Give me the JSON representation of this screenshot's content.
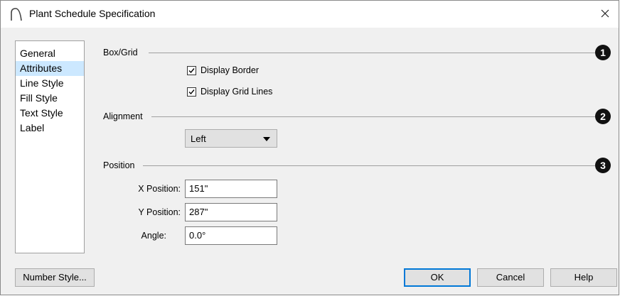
{
  "window": {
    "title": "Plant Schedule Specification",
    "close_glyph": "×",
    "icon": "arch-icon"
  },
  "sidebar": {
    "items": [
      {
        "label": "General",
        "active": false
      },
      {
        "label": "Attributes",
        "active": true
      },
      {
        "label": "Line Style",
        "active": false
      },
      {
        "label": "Fill Style",
        "active": false
      },
      {
        "label": "Text Style",
        "active": false
      },
      {
        "label": "Label",
        "active": false
      }
    ]
  },
  "box_grid": {
    "title": "Box/Grid",
    "badge": "1",
    "display_border": {
      "label": "Display Border",
      "checked": true
    },
    "display_grid_lines": {
      "label": "Display Grid Lines",
      "checked": true
    }
  },
  "alignment": {
    "title": "Alignment",
    "badge": "2",
    "selected": "Left"
  },
  "position": {
    "title": "Position",
    "badge": "3",
    "x_label": "X Position:",
    "x_value": "151\"",
    "y_label": "Y Position:",
    "y_value": "287\"",
    "angle_label": "Angle:",
    "angle_value": "0.0°"
  },
  "footer": {
    "number_style": "Number Style...",
    "ok": "OK",
    "cancel": "Cancel",
    "help": "Help"
  },
  "colors": {
    "accent": "#0078d7",
    "selection": "#cce8ff",
    "badge": "#111111"
  }
}
